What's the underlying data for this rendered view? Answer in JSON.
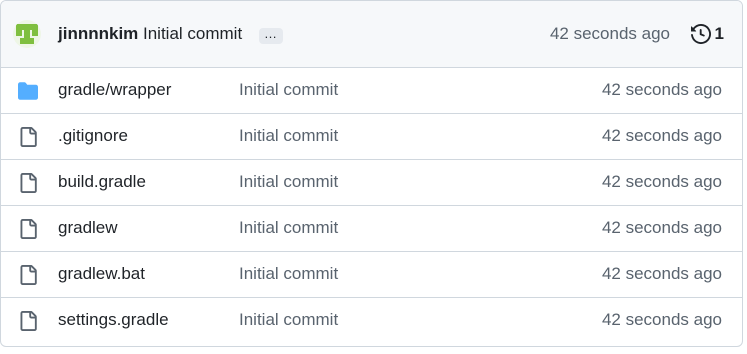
{
  "header": {
    "author": "jinnnnkim",
    "commit_message": "Initial commit",
    "ellipsis": "…",
    "time": "42 seconds ago",
    "history_count": "1",
    "avatar_color": "#7fbf3f",
    "history_icon": "history-icon"
  },
  "files": [
    {
      "name": "gradle/wrapper",
      "type": "folder",
      "message": "Initial commit",
      "time": "42 seconds ago"
    },
    {
      "name": ".gitignore",
      "type": "file",
      "message": "Initial commit",
      "time": "42 seconds ago"
    },
    {
      "name": "build.gradle",
      "type": "file",
      "message": "Initial commit",
      "time": "42 seconds ago"
    },
    {
      "name": "gradlew",
      "type": "file",
      "message": "Initial commit",
      "time": "42 seconds ago"
    },
    {
      "name": "gradlew.bat",
      "type": "file",
      "message": "Initial commit",
      "time": "42 seconds ago"
    },
    {
      "name": "settings.gradle",
      "type": "file",
      "message": "Initial commit",
      "time": "42 seconds ago"
    }
  ],
  "colors": {
    "folder": "#54aeff",
    "file_icon": "#59636e",
    "border": "#d0d7de",
    "header_bg": "#f6f8fa"
  }
}
